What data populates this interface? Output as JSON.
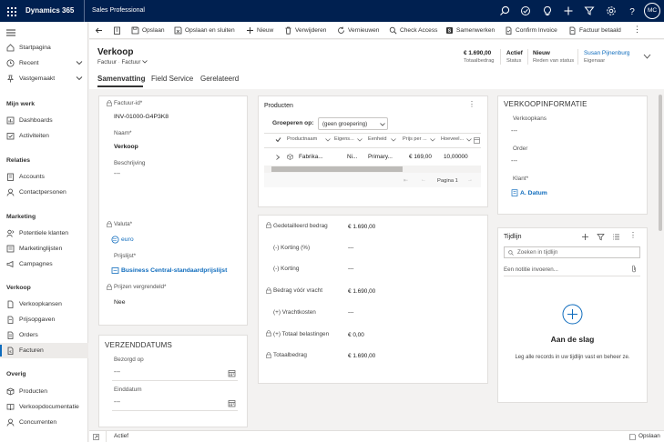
{
  "topbar": {
    "brand": "Dynamics 365",
    "app": "Sales Professional",
    "avatar_initials": "MC",
    "icons": [
      "search-icon",
      "task-icon",
      "lightbulb-icon",
      "plus-icon",
      "filter-icon",
      "gear-icon",
      "help-icon"
    ]
  },
  "sidebar": {
    "top": [
      {
        "label": "Startpagina",
        "icon": "home-icon"
      },
      {
        "label": "Recent",
        "icon": "clock-icon"
      },
      {
        "label": "Vastgemaakt",
        "icon": "pin-icon"
      }
    ],
    "groups": [
      {
        "title": "Mijn werk",
        "items": [
          {
            "label": "Dashboards"
          },
          {
            "label": "Activiteiten"
          }
        ]
      },
      {
        "title": "Relaties",
        "items": [
          {
            "label": "Accounts"
          },
          {
            "label": "Contactpersonen"
          }
        ]
      },
      {
        "title": "Marketing",
        "items": [
          {
            "label": "Potentiele klanten"
          },
          {
            "label": "Marketinglijsten"
          },
          {
            "label": "Campagnes"
          }
        ]
      },
      {
        "title": "Verkoop",
        "items": [
          {
            "label": "Verkoopkansen"
          },
          {
            "label": "Prijsopgaven"
          },
          {
            "label": "Orders"
          },
          {
            "label": "Facturen",
            "active": true
          }
        ]
      },
      {
        "title": "Overig",
        "items": [
          {
            "label": "Producten"
          },
          {
            "label": "Verkoopdocumentatie"
          },
          {
            "label": "Concurrenten"
          }
        ]
      }
    ]
  },
  "commands": [
    {
      "label": "Opslaan",
      "icon": "save-icon"
    },
    {
      "label": "Opslaan en sluiten",
      "icon": "save-close-icon"
    },
    {
      "label": "Nieuw",
      "icon": "plus-icon"
    },
    {
      "label": "Verwijderen",
      "icon": "trash-icon"
    },
    {
      "label": "Vernieuwen",
      "icon": "refresh-icon"
    },
    {
      "label": "Check Access",
      "icon": "search-icon"
    },
    {
      "label": "Samenwerken",
      "icon": "collaborate-icon"
    },
    {
      "label": "Confirm Invoice",
      "icon": "invoice-icon"
    },
    {
      "label": "Factuur betaald",
      "icon": "paid-icon"
    }
  ],
  "header": {
    "title": "Verkoop",
    "entity": "Factuur",
    "form": "Factuur",
    "fields": [
      {
        "value": "€ 1.690,00",
        "label": "Totaalbedrag"
      },
      {
        "value": "Actief",
        "label": "Status"
      },
      {
        "value": "Nieuw",
        "label": "Reden van status"
      },
      {
        "value": "Susan Pijnenburg",
        "label": "Eigenaar"
      }
    ]
  },
  "tabs": [
    {
      "label": "Samenvatting",
      "active": true
    },
    {
      "label": "Field Service"
    },
    {
      "label": "Gerelateerd"
    }
  ],
  "general": {
    "invoice_id_label": "Factuur-id*",
    "invoice_id": "INV-01000-G4P3K8",
    "name_label": "Naam*",
    "name": "Verkoop",
    "desc_label": "Beschrijving",
    "desc": "---",
    "currency_label": "Valuta*",
    "currency": "euro",
    "pricelist_label": "Prijslijst*",
    "pricelist": "Business Central-standaardprijslijst",
    "prices_locked_label": "Prijzen vergrendeld*",
    "prices_locked": "Nee"
  },
  "shipping": {
    "title": "VERZENDDATUMS",
    "delivered_label": "Bezorgd op",
    "delivered": "---",
    "end_label": "Einddatum",
    "end": "---"
  },
  "products": {
    "title": "Producten",
    "group_label": "Groeperen op:",
    "group_value": "(geen groepering)",
    "columns": [
      "Productnaam",
      "Eigens...",
      "Eenheid",
      "Prijs per ...",
      "Hoeveel..."
    ],
    "row": {
      "name": "Fabrika...",
      "owner": "Ni...",
      "unit": "Primary...",
      "price": "€ 169,00",
      "qty": "10,00000"
    },
    "page": "Pagina 1"
  },
  "summary": [
    {
      "label": "Gedetailleerd bedrag",
      "value": "€ 1.690,00",
      "locked": true
    },
    {
      "label": "(-) Korting (%)",
      "value": "---",
      "locked": false
    },
    {
      "label": "(-) Korting",
      "value": "---",
      "locked": false
    },
    {
      "label": "Bedrag vóór vracht",
      "value": "€ 1.690,00",
      "locked": true
    },
    {
      "label": "(+) Vrachtkosten",
      "value": "---",
      "locked": false
    },
    {
      "label": "(+) Totaal belastingen",
      "value": "€ 0,00",
      "locked": true
    },
    {
      "label": "Totaalbedrag",
      "value": "€ 1.690,00",
      "locked": true
    }
  ],
  "salesinfo": {
    "title": "VERKOOPINFORMATIE",
    "opp_label": "Verkoopkans",
    "opp": "---",
    "order_label": "Order",
    "order": "---",
    "customer_label": "Klant*",
    "customer": "A. Datum"
  },
  "timeline": {
    "title": "Tijdlijn",
    "search_placeholder": "Zoeken in tijdlijn",
    "note_placeholder": "Een notitie invoeren...",
    "empty_title": "Aan de slag",
    "empty_text": "Leg alle records in uw tijdlijn vast en beheer ze."
  },
  "statusbar": {
    "status": "Actief",
    "save": "Opslaan"
  },
  "colors": {
    "topbar": "#002050",
    "accent": "#0f6cbd"
  }
}
